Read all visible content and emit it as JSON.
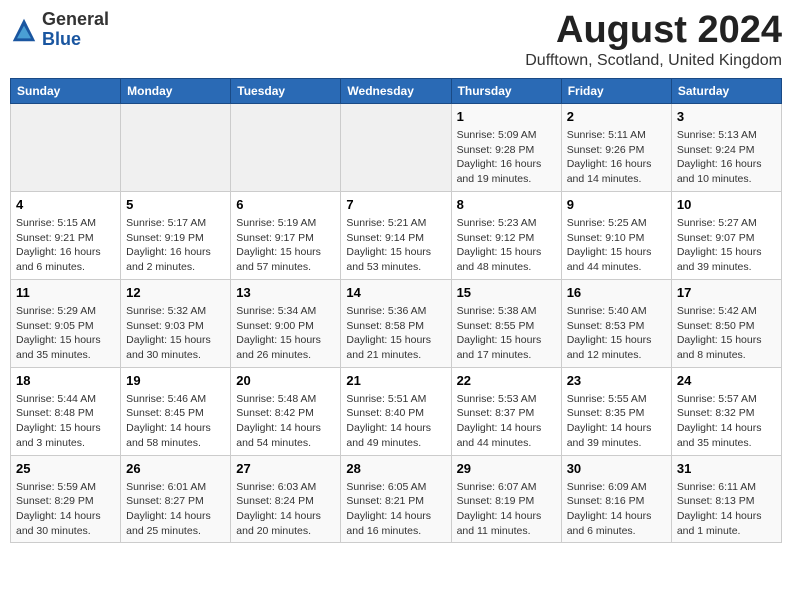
{
  "header": {
    "logo_general": "General",
    "logo_blue": "Blue",
    "month_year": "August 2024",
    "location": "Dufftown, Scotland, United Kingdom"
  },
  "weekdays": [
    "Sunday",
    "Monday",
    "Tuesday",
    "Wednesday",
    "Thursday",
    "Friday",
    "Saturday"
  ],
  "weeks": [
    [
      {
        "day": "",
        "info": ""
      },
      {
        "day": "",
        "info": ""
      },
      {
        "day": "",
        "info": ""
      },
      {
        "day": "",
        "info": ""
      },
      {
        "day": "1",
        "info": "Sunrise: 5:09 AM\nSunset: 9:28 PM\nDaylight: 16 hours and 19 minutes."
      },
      {
        "day": "2",
        "info": "Sunrise: 5:11 AM\nSunset: 9:26 PM\nDaylight: 16 hours and 14 minutes."
      },
      {
        "day": "3",
        "info": "Sunrise: 5:13 AM\nSunset: 9:24 PM\nDaylight: 16 hours and 10 minutes."
      }
    ],
    [
      {
        "day": "4",
        "info": "Sunrise: 5:15 AM\nSunset: 9:21 PM\nDaylight: 16 hours and 6 minutes."
      },
      {
        "day": "5",
        "info": "Sunrise: 5:17 AM\nSunset: 9:19 PM\nDaylight: 16 hours and 2 minutes."
      },
      {
        "day": "6",
        "info": "Sunrise: 5:19 AM\nSunset: 9:17 PM\nDaylight: 15 hours and 57 minutes."
      },
      {
        "day": "7",
        "info": "Sunrise: 5:21 AM\nSunset: 9:14 PM\nDaylight: 15 hours and 53 minutes."
      },
      {
        "day": "8",
        "info": "Sunrise: 5:23 AM\nSunset: 9:12 PM\nDaylight: 15 hours and 48 minutes."
      },
      {
        "day": "9",
        "info": "Sunrise: 5:25 AM\nSunset: 9:10 PM\nDaylight: 15 hours and 44 minutes."
      },
      {
        "day": "10",
        "info": "Sunrise: 5:27 AM\nSunset: 9:07 PM\nDaylight: 15 hours and 39 minutes."
      }
    ],
    [
      {
        "day": "11",
        "info": "Sunrise: 5:29 AM\nSunset: 9:05 PM\nDaylight: 15 hours and 35 minutes."
      },
      {
        "day": "12",
        "info": "Sunrise: 5:32 AM\nSunset: 9:03 PM\nDaylight: 15 hours and 30 minutes."
      },
      {
        "day": "13",
        "info": "Sunrise: 5:34 AM\nSunset: 9:00 PM\nDaylight: 15 hours and 26 minutes."
      },
      {
        "day": "14",
        "info": "Sunrise: 5:36 AM\nSunset: 8:58 PM\nDaylight: 15 hours and 21 minutes."
      },
      {
        "day": "15",
        "info": "Sunrise: 5:38 AM\nSunset: 8:55 PM\nDaylight: 15 hours and 17 minutes."
      },
      {
        "day": "16",
        "info": "Sunrise: 5:40 AM\nSunset: 8:53 PM\nDaylight: 15 hours and 12 minutes."
      },
      {
        "day": "17",
        "info": "Sunrise: 5:42 AM\nSunset: 8:50 PM\nDaylight: 15 hours and 8 minutes."
      }
    ],
    [
      {
        "day": "18",
        "info": "Sunrise: 5:44 AM\nSunset: 8:48 PM\nDaylight: 15 hours and 3 minutes."
      },
      {
        "day": "19",
        "info": "Sunrise: 5:46 AM\nSunset: 8:45 PM\nDaylight: 14 hours and 58 minutes."
      },
      {
        "day": "20",
        "info": "Sunrise: 5:48 AM\nSunset: 8:42 PM\nDaylight: 14 hours and 54 minutes."
      },
      {
        "day": "21",
        "info": "Sunrise: 5:51 AM\nSunset: 8:40 PM\nDaylight: 14 hours and 49 minutes."
      },
      {
        "day": "22",
        "info": "Sunrise: 5:53 AM\nSunset: 8:37 PM\nDaylight: 14 hours and 44 minutes."
      },
      {
        "day": "23",
        "info": "Sunrise: 5:55 AM\nSunset: 8:35 PM\nDaylight: 14 hours and 39 minutes."
      },
      {
        "day": "24",
        "info": "Sunrise: 5:57 AM\nSunset: 8:32 PM\nDaylight: 14 hours and 35 minutes."
      }
    ],
    [
      {
        "day": "25",
        "info": "Sunrise: 5:59 AM\nSunset: 8:29 PM\nDaylight: 14 hours and 30 minutes."
      },
      {
        "day": "26",
        "info": "Sunrise: 6:01 AM\nSunset: 8:27 PM\nDaylight: 14 hours and 25 minutes."
      },
      {
        "day": "27",
        "info": "Sunrise: 6:03 AM\nSunset: 8:24 PM\nDaylight: 14 hours and 20 minutes."
      },
      {
        "day": "28",
        "info": "Sunrise: 6:05 AM\nSunset: 8:21 PM\nDaylight: 14 hours and 16 minutes."
      },
      {
        "day": "29",
        "info": "Sunrise: 6:07 AM\nSunset: 8:19 PM\nDaylight: 14 hours and 11 minutes."
      },
      {
        "day": "30",
        "info": "Sunrise: 6:09 AM\nSunset: 8:16 PM\nDaylight: 14 hours and 6 minutes."
      },
      {
        "day": "31",
        "info": "Sunrise: 6:11 AM\nSunset: 8:13 PM\nDaylight: 14 hours and 1 minute."
      }
    ]
  ]
}
